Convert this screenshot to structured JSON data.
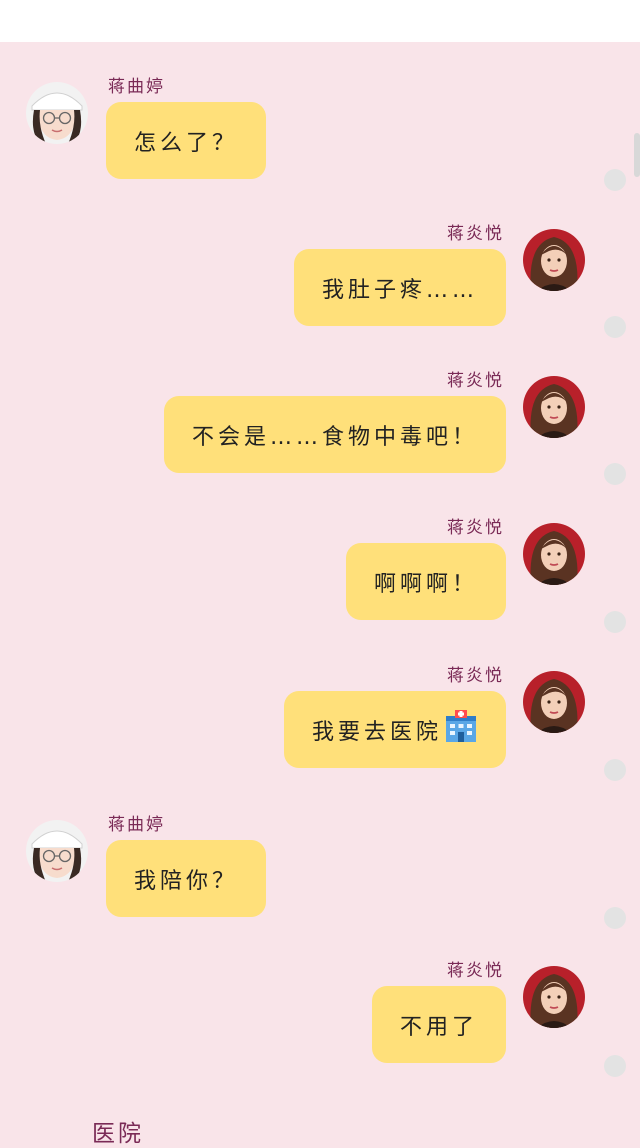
{
  "contacts": {
    "left_name": "蒋曲婷",
    "right_name": "蒋炎悦"
  },
  "messages": [
    {
      "sender": "left",
      "name": "蒋曲婷",
      "text": "怎么了？"
    },
    {
      "sender": "right",
      "name": "蒋炎悦",
      "text": "我肚子疼……"
    },
    {
      "sender": "right",
      "name": "蒋炎悦",
      "text": "不会是……食物中毒吧！"
    },
    {
      "sender": "right",
      "name": "蒋炎悦",
      "text": "啊啊啊！"
    },
    {
      "sender": "right",
      "name": "蒋炎悦",
      "text": "我要去医院",
      "icon": "hospital-icon"
    },
    {
      "sender": "left",
      "name": "蒋曲婷",
      "text": "我陪你？"
    },
    {
      "sender": "right",
      "name": "蒋炎悦",
      "text": "不用了"
    }
  ],
  "footer": {
    "text": "医院"
  },
  "colors": {
    "background": "#f9e4e9",
    "bubble": "#ffe07a",
    "name": "#7a2a56"
  }
}
